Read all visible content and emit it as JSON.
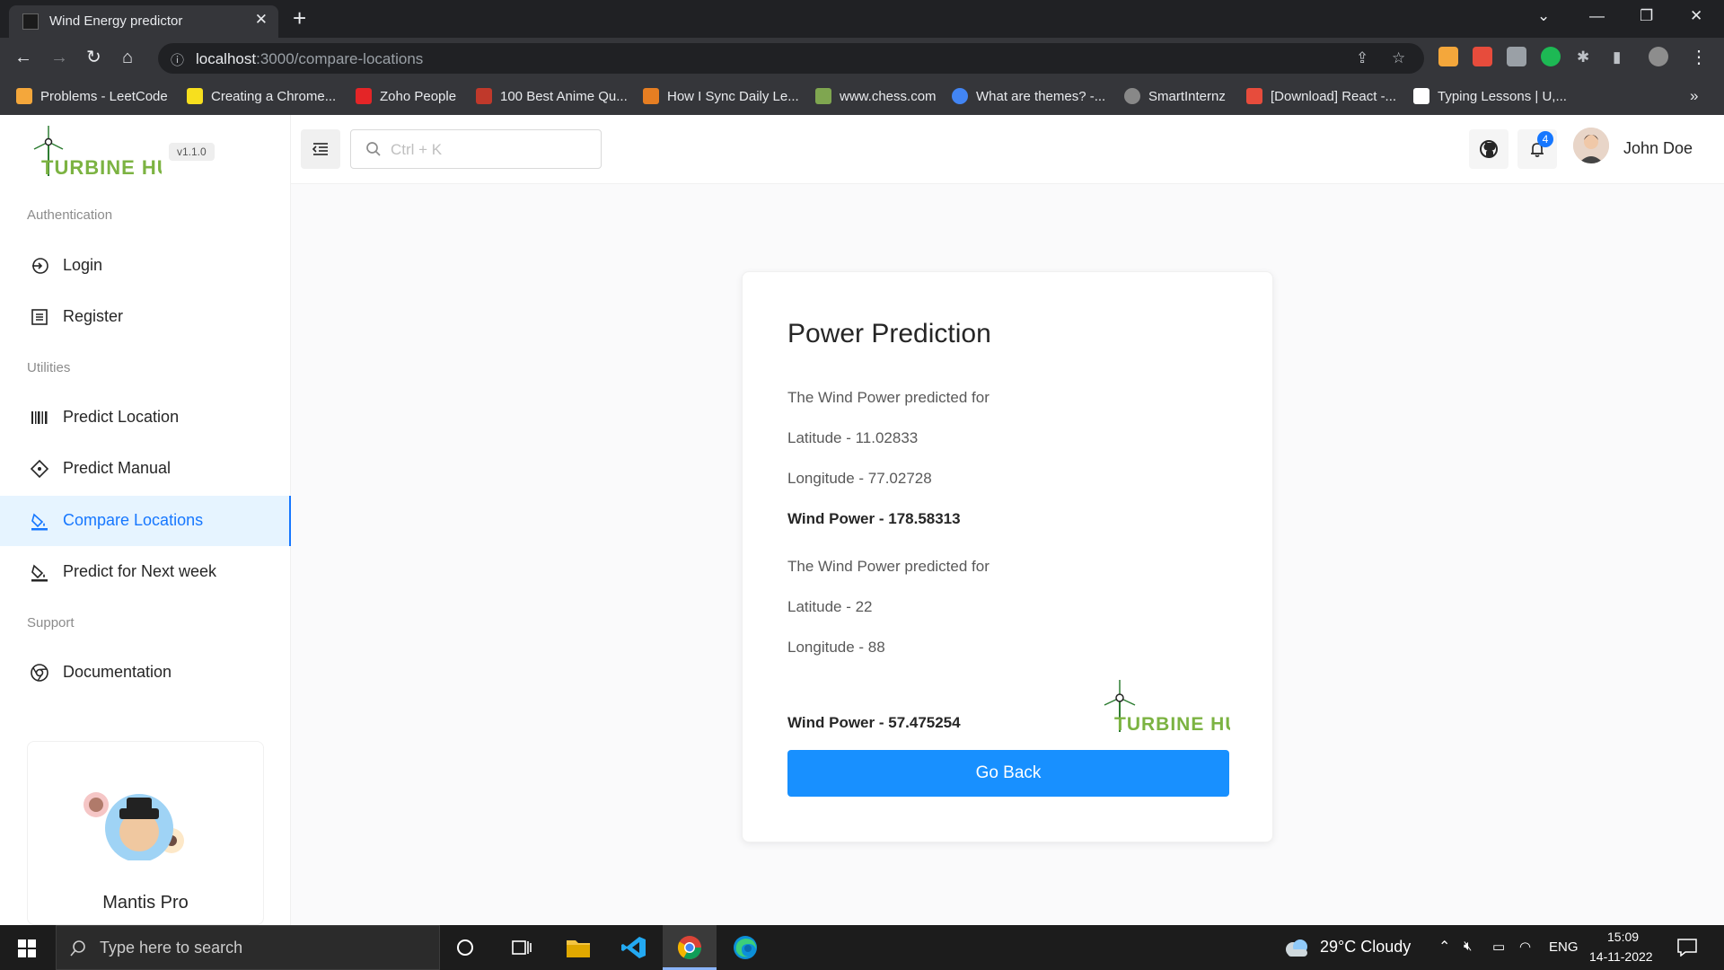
{
  "browser": {
    "tab_title": "Wind Energy predictor",
    "url_host": "localhost",
    "url_rest": ":3000/compare-locations",
    "bookmarks": [
      {
        "label": "Problems - LeetCode",
        "color": "#f4a73b"
      },
      {
        "label": "Creating a Chrome...",
        "color": "#f7df1e"
      },
      {
        "label": "Zoho People",
        "color": "#e42527"
      },
      {
        "label": "100 Best Anime Qu...",
        "color": "#c0392b"
      },
      {
        "label": "How I Sync Daily Le...",
        "color": "#e67e22"
      },
      {
        "label": "www.chess.com",
        "color": "#7fa650"
      },
      {
        "label": "What are themes? -...",
        "color": "#4285f4"
      },
      {
        "label": "SmartInternz",
        "color": "#888888"
      },
      {
        "label": "[Download] React -...",
        "color": "#e74c3c"
      },
      {
        "label": "Typing Lessons | U,...",
        "color": "#ffffff"
      }
    ]
  },
  "sidebar": {
    "brand": "TURBINE HUT",
    "version": "v1.1.0",
    "sections": {
      "authentication": "Authentication",
      "utilities": "Utilities",
      "support": "Support"
    },
    "items": {
      "login": "Login",
      "register": "Register",
      "predict_location": "Predict Location",
      "predict_manual": "Predict Manual",
      "compare_locations": "Compare Locations",
      "predict_next_week": "Predict for Next week",
      "documentation": "Documentation"
    },
    "promo_title": "Mantis Pro"
  },
  "header": {
    "search_placeholder": "Ctrl + K",
    "notification_count": "4",
    "user_name": "John Doe"
  },
  "card": {
    "title": "Power Prediction",
    "loc1_intro": "The Wind Power predicted for",
    "loc1_lat": "Latitude - 11.02833",
    "loc1_lon": "Longitude - 77.02728",
    "loc1_power": "Wind Power - 178.58313",
    "loc2_intro": "The Wind Power predicted for",
    "loc2_lat": "Latitude - 22",
    "loc2_lon": "Longitude - 88",
    "loc2_power": "Wind Power - 57.475254",
    "logo_text": "TURBINE HUT",
    "button": "Go Back"
  },
  "taskbar": {
    "search_placeholder": "Type here to search",
    "weather": "29°C  Cloudy",
    "language": "ENG",
    "time": "15:09",
    "date": "14-11-2022"
  },
  "colors": {
    "accent": "#1677ff",
    "button": "#1890ff",
    "logo_green": "#7cb342"
  }
}
